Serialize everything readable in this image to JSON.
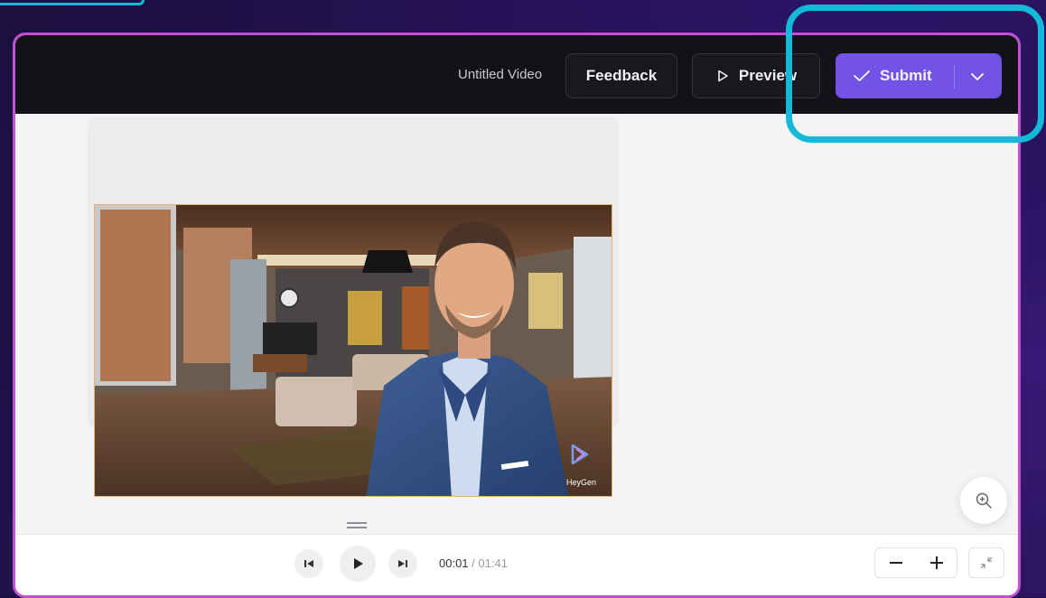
{
  "header": {
    "video_title": "Untitled Video",
    "feedback_label": "Feedback",
    "preview_label": "Preview",
    "submit_label": "Submit"
  },
  "video": {
    "watermark": "HeyGen"
  },
  "player": {
    "current_time": "00:01",
    "separator": "/",
    "total_time": "01:41"
  },
  "colors": {
    "accent": "#7352e6",
    "highlight": "#12b9d8",
    "frame_border": "#c44fd6",
    "header_bg": "#131317"
  },
  "icons": [
    "check-icon",
    "chevron-down-icon",
    "play-outline-icon",
    "zoom-in-icon",
    "skip-back-icon",
    "play-icon",
    "skip-forward-icon",
    "minus-icon",
    "plus-icon",
    "collapse-icon",
    "drag-handle-icon"
  ]
}
